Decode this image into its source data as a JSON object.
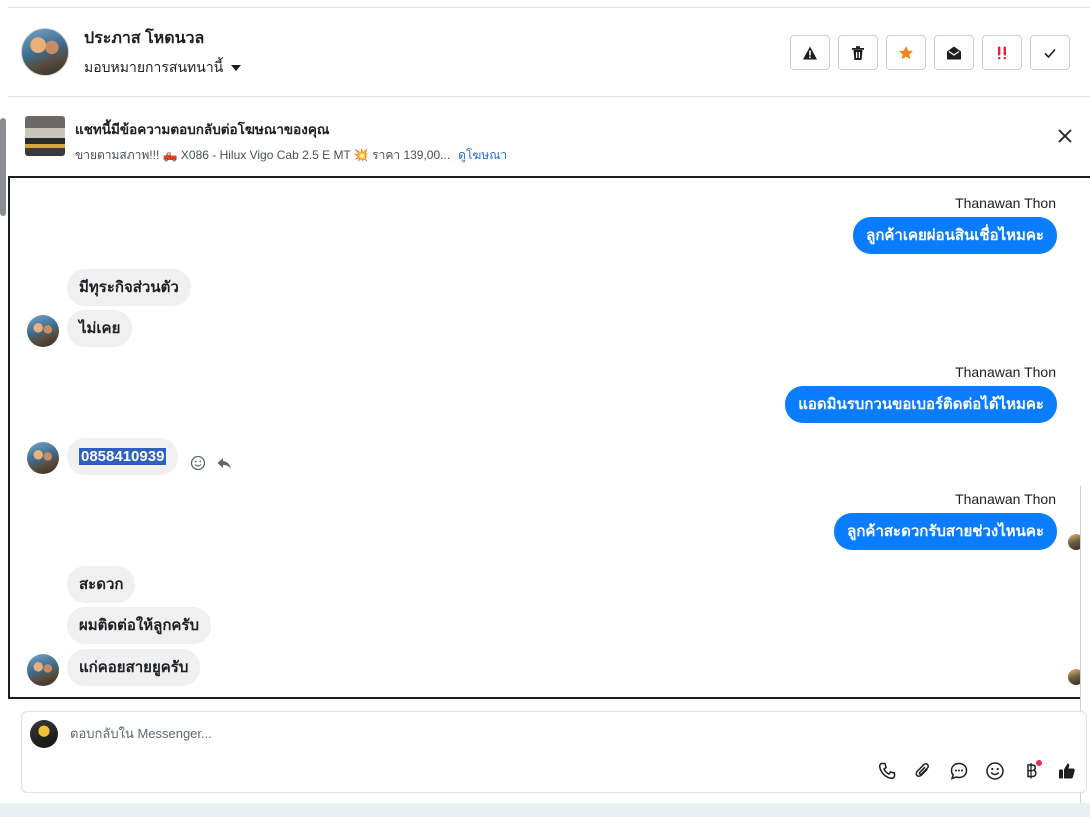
{
  "header": {
    "contact_name": "ประภาส โหดนวล",
    "assign_label": "มอบหมายการสนทนานี้",
    "actions": [
      {
        "name": "report-spam",
        "icon": "warning-icon"
      },
      {
        "name": "delete",
        "icon": "trash-icon"
      },
      {
        "name": "star",
        "icon": "star-icon"
      },
      {
        "name": "mark-unread",
        "icon": "envelope-open-icon"
      },
      {
        "name": "follow-up",
        "icon": "exclamation-icon"
      },
      {
        "name": "done",
        "icon": "check-icon"
      }
    ]
  },
  "ad": {
    "title": "แชทนี้มีข้อความตอบกลับต่อโฆษณาของคุณ",
    "subtitle": "ขายตามสภาพ!!! 🛻 X086 - Hilux Vigo Cab 2.5 E MT 💥 ราคา 139,00...",
    "link": "ดูโฆษณา"
  },
  "messages": [
    {
      "sender": "Thanawan Thon",
      "direction": "out",
      "text": "ลูกค้าเคยผ่อนสินเชื่อไหมคะ"
    },
    {
      "direction": "in",
      "text": "มีทุระกิจส่วนตัว"
    },
    {
      "direction": "in",
      "text": "ไม่เคย"
    },
    {
      "sender": "Thanawan Thon",
      "direction": "out",
      "text": "แอดมินรบกวนขอเบอร์ติดต่อได้ไหมคะ"
    },
    {
      "direction": "in",
      "text": "0858410939",
      "selected": true
    },
    {
      "sender": "Thanawan Thon",
      "direction": "out",
      "text": "ลูกค้าสะดวกรับสายช่วงไหนคะ"
    },
    {
      "direction": "in",
      "text": "สะดวก"
    },
    {
      "direction": "in",
      "text": "ผมติดต่อให้ลูกครับ"
    },
    {
      "direction": "in",
      "text": "แก่คอยสายยูครับ"
    }
  ],
  "composer": {
    "placeholder": "ตอบกลับใน Messenger...",
    "tools": [
      "phone-icon",
      "paperclip-icon",
      "saved-reply-icon",
      "emoji-icon",
      "baht-icon",
      "thumbs-up-icon"
    ]
  },
  "colors": {
    "outgoing_bubble": "#0a7cff",
    "incoming_bubble": "#f0f0f0",
    "link": "#216fdb",
    "star": "#f5811f",
    "follow_up": "#e41e3f"
  }
}
